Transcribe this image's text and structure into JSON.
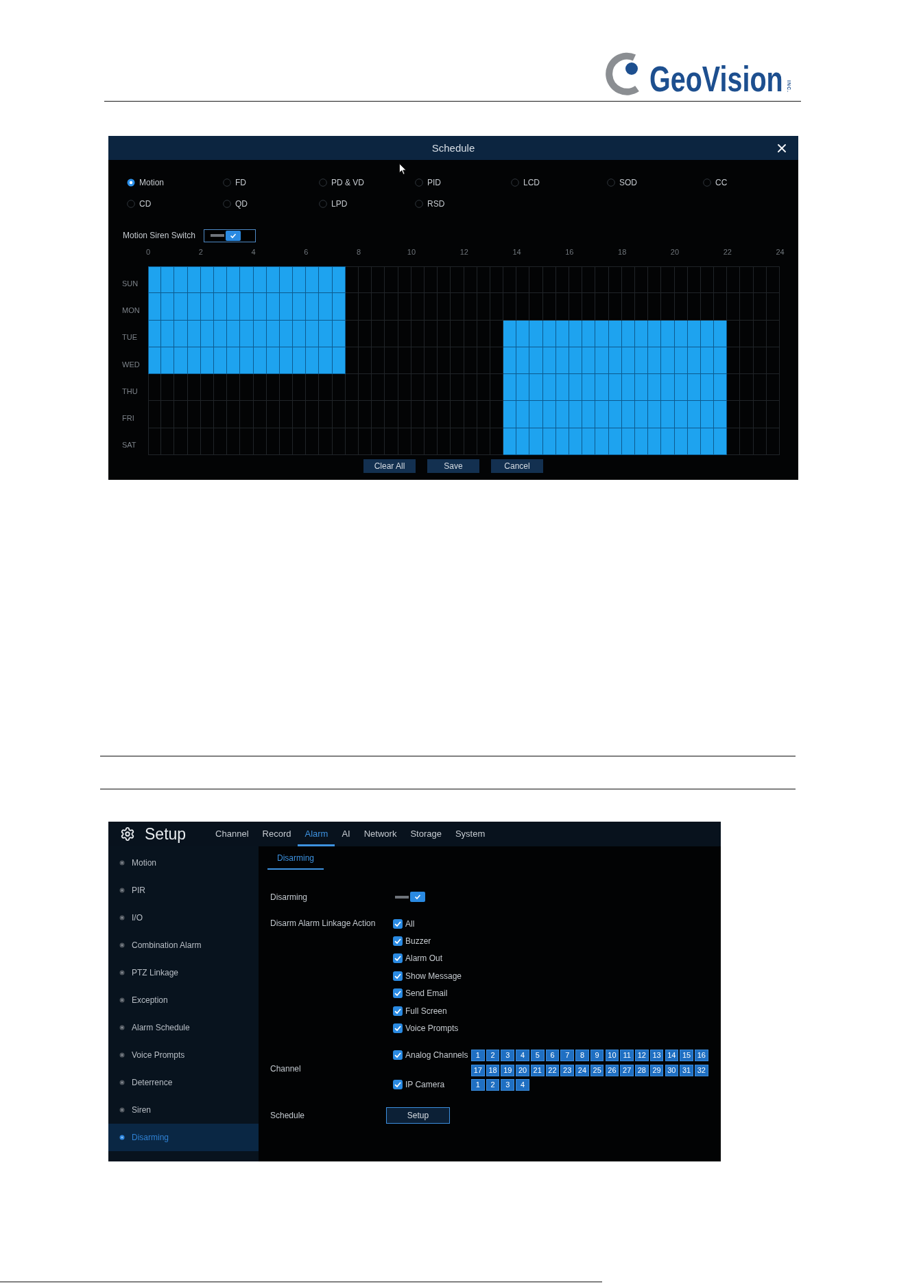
{
  "header": {
    "logo": {
      "wordmark": "GeoVision",
      "suffix": "INC."
    }
  },
  "schedule_dialog": {
    "title": "Schedule",
    "detection_types": [
      {
        "label": "Motion",
        "selected": true
      },
      {
        "label": "FD",
        "selected": false
      },
      {
        "label": "PD & VD",
        "selected": false
      },
      {
        "label": "PID",
        "selected": false
      },
      {
        "label": "LCD",
        "selected": false
      },
      {
        "label": "SOD",
        "selected": false
      },
      {
        "label": "CC",
        "selected": false
      },
      {
        "label": "CD",
        "selected": false
      },
      {
        "label": "QD",
        "selected": false
      },
      {
        "label": "LPD",
        "selected": false
      },
      {
        "label": "RSD",
        "selected": false
      }
    ],
    "siren_switch": {
      "label": "Motion Siren Switch",
      "on": true
    },
    "hours": [
      "0",
      "2",
      "4",
      "6",
      "8",
      "10",
      "12",
      "14",
      "16",
      "18",
      "20",
      "22",
      "24"
    ],
    "rows": [
      {
        "day": "SUN",
        "slots": [
          true,
          true,
          true,
          true,
          true,
          true,
          true,
          true,
          true,
          true,
          true,
          true,
          true,
          true,
          true,
          false,
          false,
          false,
          false,
          false,
          false,
          false,
          false,
          false,
          false,
          false,
          false,
          false,
          false,
          false,
          false,
          false,
          false,
          false,
          false,
          false,
          false,
          false,
          false,
          false,
          false,
          false,
          false,
          false,
          false,
          false,
          false,
          false
        ]
      },
      {
        "day": "MON",
        "slots": [
          true,
          true,
          true,
          true,
          true,
          true,
          true,
          true,
          true,
          true,
          true,
          true,
          true,
          true,
          true,
          false,
          false,
          false,
          false,
          false,
          false,
          false,
          false,
          false,
          false,
          false,
          false,
          false,
          false,
          false,
          false,
          false,
          false,
          false,
          false,
          false,
          false,
          false,
          false,
          false,
          false,
          false,
          false,
          false,
          false,
          false,
          false,
          false
        ]
      },
      {
        "day": "TUE",
        "slots": [
          true,
          true,
          true,
          true,
          true,
          true,
          true,
          true,
          true,
          true,
          true,
          true,
          true,
          true,
          true,
          false,
          false,
          false,
          false,
          false,
          false,
          false,
          false,
          false,
          false,
          false,
          false,
          true,
          true,
          true,
          true,
          true,
          true,
          true,
          true,
          true,
          true,
          true,
          true,
          true,
          true,
          true,
          true,
          true,
          false,
          false,
          false,
          false
        ]
      },
      {
        "day": "WED",
        "slots": [
          true,
          true,
          true,
          true,
          true,
          true,
          true,
          true,
          true,
          true,
          true,
          true,
          true,
          true,
          true,
          false,
          false,
          false,
          false,
          false,
          false,
          false,
          false,
          false,
          false,
          false,
          false,
          true,
          true,
          true,
          true,
          true,
          true,
          true,
          true,
          true,
          true,
          true,
          true,
          true,
          true,
          true,
          true,
          true,
          false,
          false,
          false,
          false
        ]
      },
      {
        "day": "THU",
        "slots": [
          false,
          false,
          false,
          false,
          false,
          false,
          false,
          false,
          false,
          false,
          false,
          false,
          false,
          false,
          false,
          false,
          false,
          false,
          false,
          false,
          false,
          false,
          false,
          false,
          false,
          false,
          false,
          true,
          true,
          true,
          true,
          true,
          true,
          true,
          true,
          true,
          true,
          true,
          true,
          true,
          true,
          true,
          true,
          true,
          false,
          false,
          false,
          false
        ]
      },
      {
        "day": "FRI",
        "slots": [
          false,
          false,
          false,
          false,
          false,
          false,
          false,
          false,
          false,
          false,
          false,
          false,
          false,
          false,
          false,
          false,
          false,
          false,
          false,
          false,
          false,
          false,
          false,
          false,
          false,
          false,
          false,
          true,
          true,
          true,
          true,
          true,
          true,
          true,
          true,
          true,
          true,
          true,
          true,
          true,
          true,
          true,
          true,
          true,
          false,
          false,
          false,
          false
        ]
      },
      {
        "day": "SAT",
        "slots": [
          false,
          false,
          false,
          false,
          false,
          false,
          false,
          false,
          false,
          false,
          false,
          false,
          false,
          false,
          false,
          false,
          false,
          false,
          false,
          false,
          false,
          false,
          false,
          false,
          false,
          false,
          false,
          true,
          true,
          true,
          true,
          true,
          true,
          true,
          true,
          true,
          true,
          true,
          true,
          true,
          true,
          true,
          true,
          true,
          false,
          false,
          false,
          false
        ]
      }
    ],
    "buttons": [
      "Clear All",
      "Save",
      "Cancel"
    ]
  },
  "setup": {
    "title": "Setup",
    "tabs": [
      {
        "label": "Channel",
        "selected": false
      },
      {
        "label": "Record",
        "selected": false
      },
      {
        "label": "Alarm",
        "selected": true
      },
      {
        "label": "AI",
        "selected": false
      },
      {
        "label": "Network",
        "selected": false
      },
      {
        "label": "Storage",
        "selected": false
      },
      {
        "label": "System",
        "selected": false
      }
    ],
    "sidebar": {
      "items": [
        {
          "label": "Motion",
          "selected": false
        },
        {
          "label": "PIR",
          "selected": false
        },
        {
          "label": "I/O",
          "selected": false
        },
        {
          "label": "Combination Alarm",
          "selected": false
        },
        {
          "label": "PTZ Linkage",
          "selected": false
        },
        {
          "label": "Exception",
          "selected": false
        },
        {
          "label": "Alarm Schedule",
          "selected": false
        },
        {
          "label": "Voice Prompts",
          "selected": false
        },
        {
          "label": "Deterrence",
          "selected": false
        },
        {
          "label": "Siren",
          "selected": false
        },
        {
          "label": "Disarming",
          "selected": true
        }
      ]
    },
    "subtabs": [
      {
        "label": "Disarming",
        "selected": true
      }
    ],
    "disarming": {
      "label": "Disarming",
      "on": true
    },
    "linkage": {
      "label": "Disarm Alarm Linkage Action",
      "options": [
        {
          "label": "All",
          "checked": true
        },
        {
          "label": "Buzzer",
          "checked": true
        },
        {
          "label": "Alarm Out",
          "checked": true
        },
        {
          "label": "Show Message",
          "checked": true
        },
        {
          "label": "Send Email",
          "checked": true
        },
        {
          "label": "Full Screen",
          "checked": true
        },
        {
          "label": "Voice Prompts",
          "checked": true
        }
      ]
    },
    "channel": {
      "label": "Channel",
      "groups": [
        {
          "label": "Analog Channels",
          "checked": true,
          "channels": [
            {
              "label": "1",
              "selected": true
            },
            {
              "label": "2",
              "selected": true
            },
            {
              "label": "3",
              "selected": true
            },
            {
              "label": "4",
              "selected": true
            },
            {
              "label": "5",
              "selected": true
            },
            {
              "label": "6",
              "selected": true
            },
            {
              "label": "7",
              "selected": true
            },
            {
              "label": "8",
              "selected": true
            },
            {
              "label": "9",
              "selected": true
            },
            {
              "label": "10",
              "selected": true
            },
            {
              "label": "11",
              "selected": true
            },
            {
              "label": "12",
              "selected": true
            },
            {
              "label": "13",
              "selected": true
            },
            {
              "label": "14",
              "selected": true
            },
            {
              "label": "15",
              "selected": true
            },
            {
              "label": "16",
              "selected": true
            },
            {
              "label": "17",
              "selected": true
            },
            {
              "label": "18",
              "selected": true
            },
            {
              "label": "19",
              "selected": true
            },
            {
              "label": "20",
              "selected": true
            },
            {
              "label": "21",
              "selected": true
            },
            {
              "label": "22",
              "selected": true
            },
            {
              "label": "23",
              "selected": true
            },
            {
              "label": "24",
              "selected": true
            },
            {
              "label": "25",
              "selected": true
            },
            {
              "label": "26",
              "selected": true
            },
            {
              "label": "27",
              "selected": true
            },
            {
              "label": "28",
              "selected": true
            },
            {
              "label": "29",
              "selected": true
            },
            {
              "label": "30",
              "selected": true
            },
            {
              "label": "31",
              "selected": true
            },
            {
              "label": "32",
              "selected": true
            }
          ]
        },
        {
          "label": "IP Camera",
          "checked": true,
          "channels": [
            {
              "label": "1",
              "selected": true
            },
            {
              "label": "2",
              "selected": true
            },
            {
              "label": "3",
              "selected": true
            },
            {
              "label": "4",
              "selected": true
            }
          ]
        }
      ]
    },
    "schedule": {
      "label": "Schedule",
      "button": "Setup"
    }
  }
}
